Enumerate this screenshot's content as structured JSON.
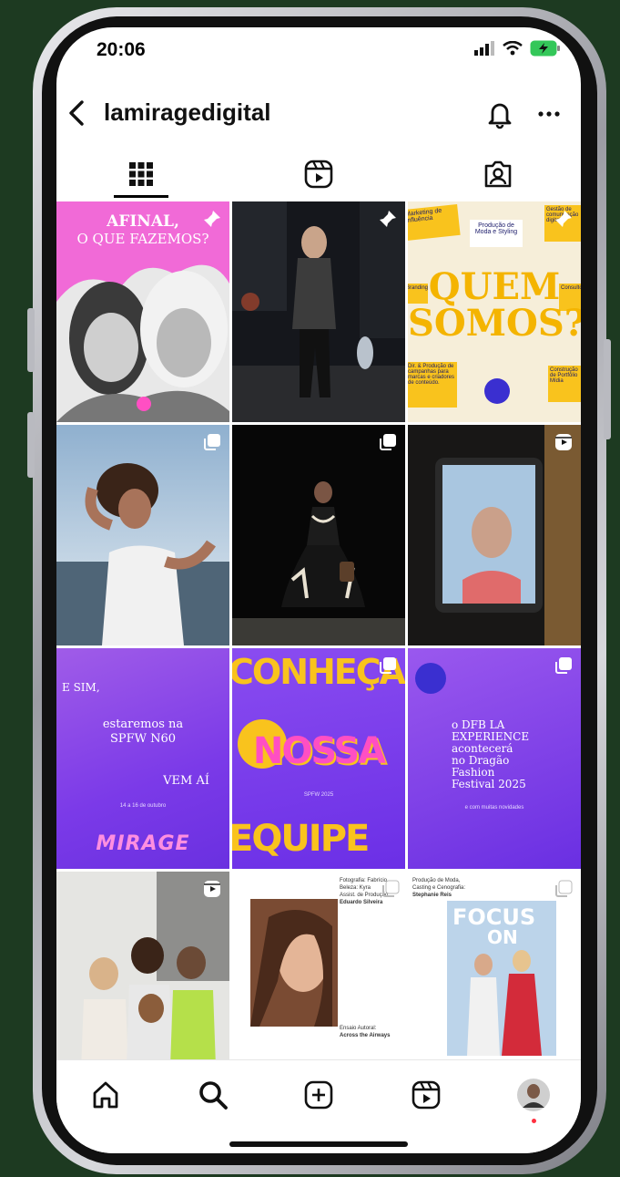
{
  "status": {
    "time": "20:06"
  },
  "header": {
    "username": "lamiragedigital"
  },
  "tabs": [
    {
      "name": "grid",
      "icon": "grid-icon",
      "active": true
    },
    {
      "name": "reels",
      "icon": "reels-icon",
      "active": false
    },
    {
      "name": "tagged",
      "icon": "tagged-icon",
      "active": false
    }
  ],
  "posts": {
    "p1": {
      "line1": "AFINAL,",
      "line2": "O QUE FAZEMOS?",
      "badge": "pin-icon"
    },
    "p2": {
      "badge": "pin-icon"
    },
    "p3": {
      "line1": "QUEM",
      "line2": "SOMOS?",
      "note1": "Marketing de Influência",
      "note2": "Produção de Moda e Styling",
      "note3": "Gestão de comunicação digital",
      "note4": "Branding",
      "note5": "Consultoria",
      "note6": "Dir. & Produção de campanhas para marcas e criadores de conteúdo.",
      "note7": "Construção de Portfólio Mídia",
      "badge": "pin-icon"
    },
    "p4": {
      "badge": "carousel-icon"
    },
    "p5": {
      "badge": "carousel-icon"
    },
    "p6": {
      "badge": "reel-icon"
    },
    "p7": {
      "l1": "E SIM,",
      "l2": "estaremos na",
      "l3": "SPFW N60",
      "l4": "VEM AÍ",
      "l5": "14 a 16 de outubro",
      "logo": "MIRAGE"
    },
    "p8": {
      "l1": "CONHEÇA",
      "l2": "NOSSA",
      "l3": "EQUIPE",
      "small": "SPFW 2025",
      "badge": "carousel-icon"
    },
    "p9": {
      "l1": "o DFB LA",
      "l2": "EXPERIENCE",
      "l3": "acontecerá",
      "l4": "no Dragão",
      "l5": "Fashion",
      "l6": "Festival 2025",
      "small": "e com muitas novidades",
      "badge": "carousel-icon"
    },
    "p10": {
      "badge": "reel-icon"
    },
    "p11": {
      "c1": "Fotografia: Fabrício",
      "c2": "Beleza: Kyra",
      "c3": "Assist. de Produção:",
      "c4": "Eduardo Silveira",
      "c5": "Ensaio Autoral:",
      "c6": "Across the Airways",
      "c7": "Produção de Moda,",
      "c8": "Casting e Cenografia:",
      "c9": "Stephanie Reis",
      "mag": "FOCUS",
      "mag2": "ON",
      "badge": "carousel-icon"
    }
  },
  "nav": [
    {
      "name": "home",
      "icon": "home-icon"
    },
    {
      "name": "search",
      "icon": "search-icon"
    },
    {
      "name": "create",
      "icon": "plus-square-icon"
    },
    {
      "name": "reels",
      "icon": "reels-icon"
    },
    {
      "name": "profile",
      "icon": "avatar-icon"
    }
  ],
  "colors": {
    "background": "#1d3a21",
    "accent_purple": "#8a3ff0",
    "accent_pink": "#ff4fc3",
    "accent_yellow": "#f9c31d"
  }
}
